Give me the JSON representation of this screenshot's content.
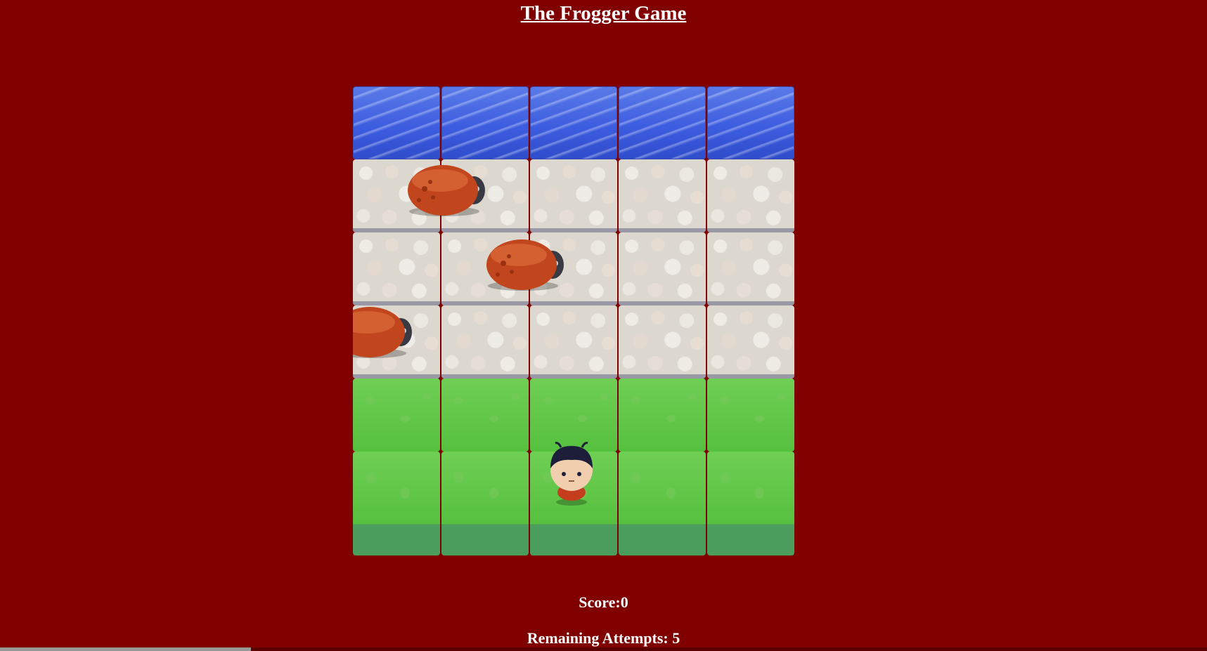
{
  "game": {
    "title": "The Frogger Game",
    "score_text": "Score:0",
    "attempts_text": "Remaining Attempts: 5"
  },
  "board": {
    "columns": 5,
    "rows": [
      "water",
      "stone",
      "stone",
      "stone",
      "grass",
      "grass"
    ]
  },
  "sprites": {
    "enemies": [
      {
        "name": "enemy-bug"
      },
      {
        "name": "enemy-bug"
      },
      {
        "name": "enemy-bug"
      }
    ],
    "player": {
      "name": "player-boy"
    }
  },
  "colors": {
    "background": "#800000",
    "text": "#ffffff"
  }
}
